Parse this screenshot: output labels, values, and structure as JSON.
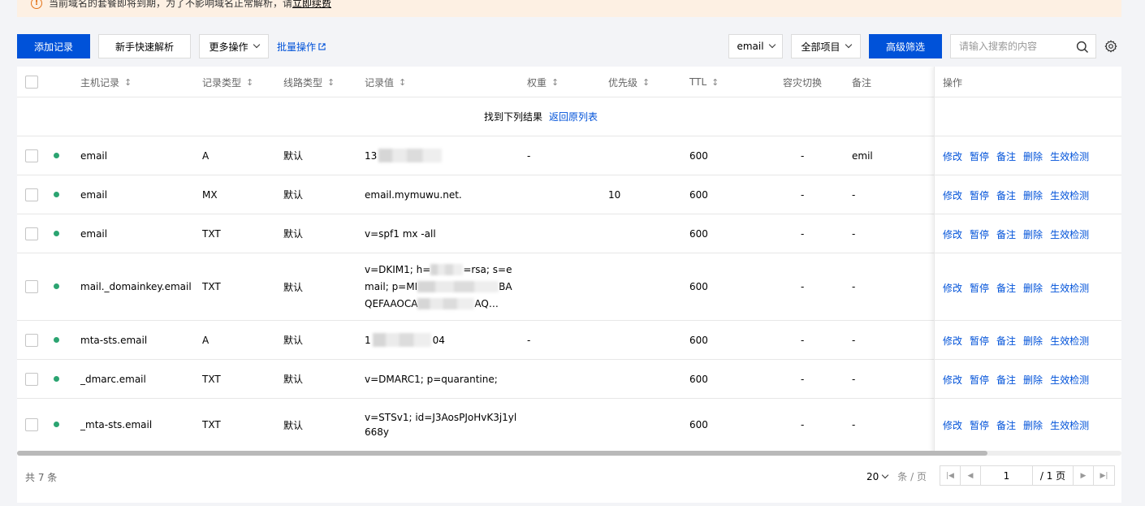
{
  "notice": {
    "text": "当前域名的套餐即将到期，为了不影响域名正常解析，请",
    "link": "立即续费"
  },
  "toolbar": {
    "add_record": "添加记录",
    "quick_parse": "新手快速解析",
    "more_ops": "更多操作",
    "batch_ops": "批量操作",
    "filter_subdomain": "email",
    "filter_project": "全部项目",
    "advanced_filter": "高级筛选",
    "search_placeholder": "请输入搜索的内容"
  },
  "columns": {
    "host": "主机记录",
    "type": "记录类型",
    "line": "线路类型",
    "value": "记录值",
    "weight": "权重",
    "priority": "优先级",
    "ttl": "TTL",
    "failover": "容灾切换",
    "remark": "备注",
    "actions": "操作"
  },
  "search_result": {
    "text": "找到下列结果",
    "back": "返回原列表"
  },
  "actions": [
    "修改",
    "暂停",
    "备注",
    "删除",
    "生效检测"
  ],
  "records": [
    {
      "host": "email",
      "type": "A",
      "line": "默认",
      "value_prefix": "13",
      "value_suffix": "",
      "weight": "-",
      "priority": "",
      "ttl": "600",
      "failover": "-",
      "remark": "emil"
    },
    {
      "host": "email",
      "type": "MX",
      "line": "默认",
      "value": "email.mymuwu.net.",
      "weight": "",
      "priority": "10",
      "ttl": "600",
      "failover": "-",
      "remark": "-"
    },
    {
      "host": "email",
      "type": "TXT",
      "line": "默认",
      "value": "v=spf1 mx -all",
      "weight": "",
      "priority": "",
      "ttl": "600",
      "failover": "-",
      "remark": "-"
    },
    {
      "host": "mail._domainkey.email",
      "type": "TXT",
      "line": "默认",
      "value_lines": [
        "v=DKIM1; h=",
        "=rsa; s=e",
        "mail; p=MI",
        "BA",
        "QEFAAOCA",
        "AQ…"
      ],
      "weight": "",
      "priority": "",
      "ttl": "600",
      "failover": "-",
      "remark": "-"
    },
    {
      "host": "mta-sts.email",
      "type": "A",
      "line": "默认",
      "value_prefix": "1",
      "value_suffix": "04",
      "weight": "-",
      "priority": "",
      "ttl": "600",
      "failover": "-",
      "remark": "-"
    },
    {
      "host": "_dmarc.email",
      "type": "TXT",
      "line": "默认",
      "value": "v=DMARC1; p=quarantine;",
      "weight": "",
      "priority": "",
      "ttl": "600",
      "failover": "-",
      "remark": "-"
    },
    {
      "host": "_mta-sts.email",
      "type": "TXT",
      "line": "默认",
      "value_lines": [
        "v=STSv1; id=J3AosPJoHvK3j1yl",
        "668y"
      ],
      "weight": "",
      "priority": "",
      "ttl": "600",
      "failover": "-",
      "remark": "-"
    }
  ],
  "footer": {
    "total": "共 7 条",
    "page_size": "20",
    "page_size_unit": "条 / 页",
    "current_page": "1",
    "total_pages": "/ 1 页"
  }
}
